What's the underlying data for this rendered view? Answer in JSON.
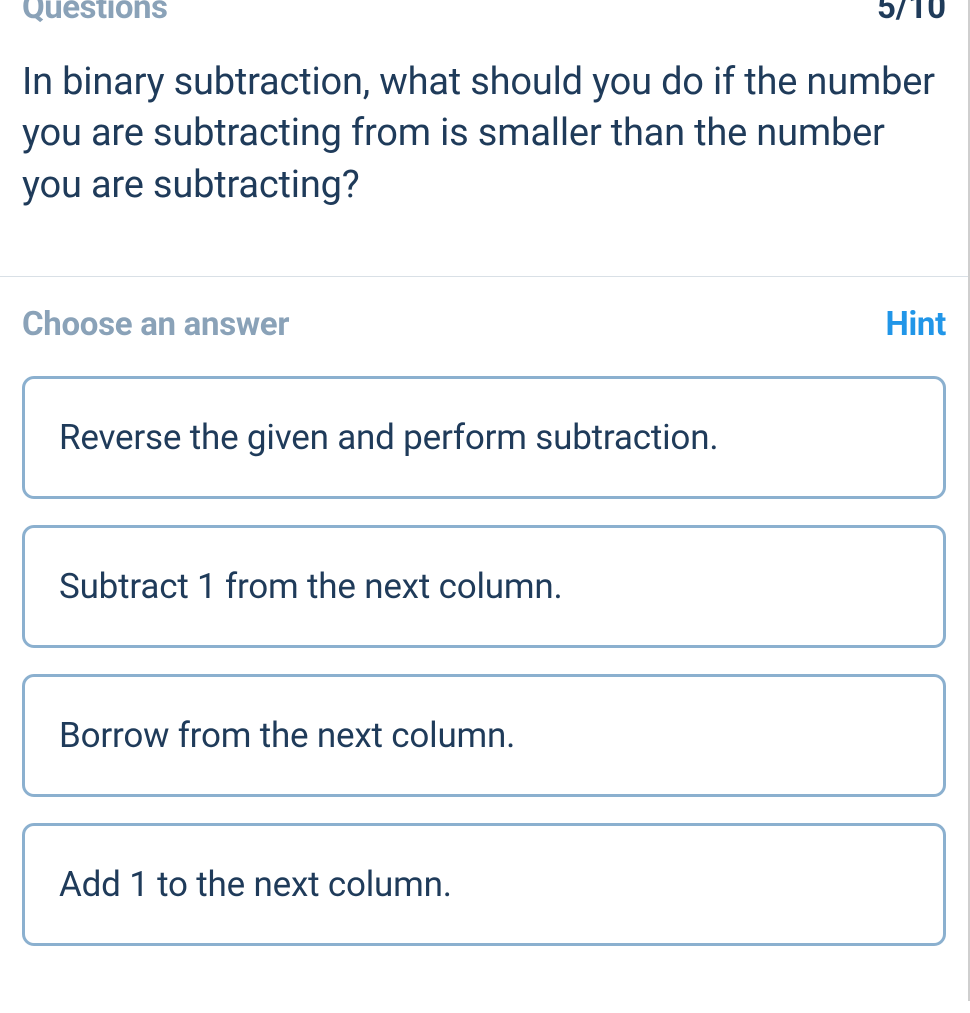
{
  "header": {
    "section_label": "Questions",
    "progress": "5/10"
  },
  "question": {
    "text": "In binary subtraction, what should you do if the number you are subtracting from is smaller than the number you are subtracting?"
  },
  "answer_section": {
    "choose_label": "Choose an answer",
    "hint_label": "Hint",
    "options": [
      "Reverse the given and perform subtraction.",
      "Subtract 1 from the next column.",
      "Borrow from the next column.",
      "Add 1 to the next column."
    ]
  }
}
